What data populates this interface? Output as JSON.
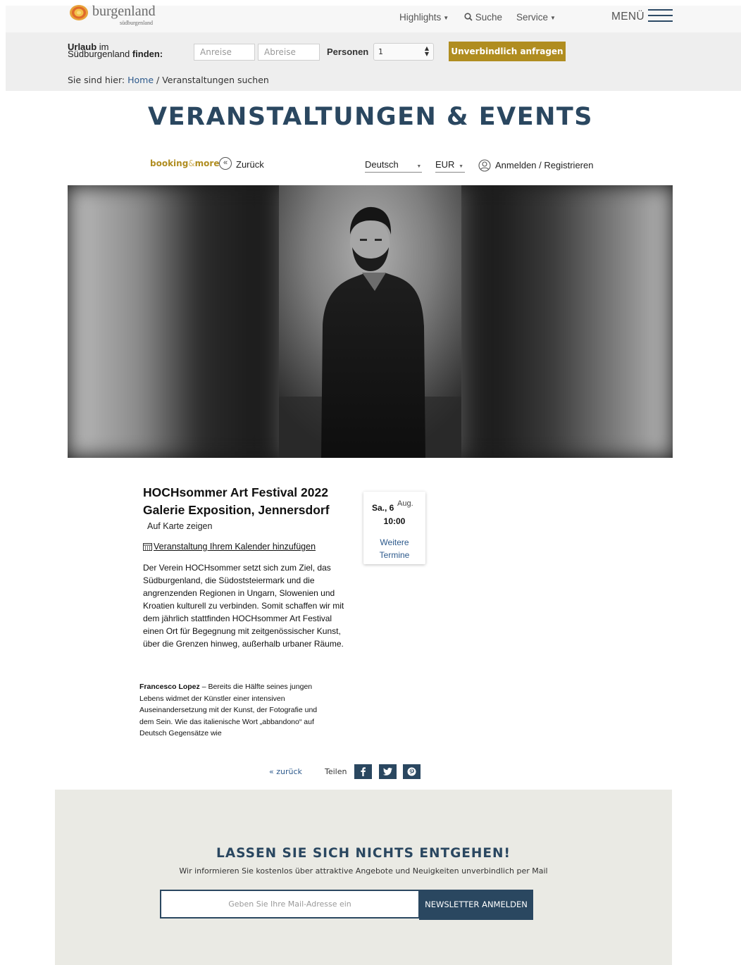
{
  "header": {
    "logo": {
      "name": "burgenland",
      "sub": "südburgenland"
    },
    "nav": [
      {
        "label": "Highlights",
        "has_caret": true
      },
      {
        "label": "Suche",
        "icon": "search-icon"
      },
      {
        "label": "Service",
        "has_caret": true
      }
    ],
    "menu_label": "MENÜ"
  },
  "booking_bar": {
    "label_bold_1": "Urlaub",
    "label_1": " im",
    "label_2": "Südburgenland ",
    "label_bold_2": "finden:",
    "arrival_placeholder": "Anreise",
    "departure_placeholder": "Abreise",
    "persons_label": "Personen",
    "persons_value": "1",
    "inquire_button": "Unverbindlich anfragen"
  },
  "breadcrumb": {
    "prefix": "Sie sind hier:",
    "home": "Home",
    "separator": " / ",
    "current": "Veranstaltungen suchen"
  },
  "page_title": "VERANSTALTUNGEN & EVENTS",
  "toolbar": {
    "brand_part1": "booking",
    "brand_amp": "&",
    "brand_part2": "more",
    "back_label": "Zurück",
    "language": "Deutsch",
    "currency": "EUR",
    "login_label": "Anmelden / Registrieren"
  },
  "event": {
    "title_line1": "HOCHsommer Art Festival 2022",
    "title_line2": "Galerie Exposition, Jennersdorf",
    "map_link": "Auf Karte zeigen",
    "calendar_link": "Veranstaltung Ihrem Kalender hinzufügen",
    "description": "Der Verein HOCHsommer setzt sich zum Ziel, das Südburgenland, die Südoststeiermark und die angrenzenden Regionen in Ungarn, Slowenien und Kroatien kulturell zu verbinden. Somit schaffen wir mit dem jährlich stattfinden HOCHsommer Art Festival einen Ort für Begegnung mit zeitgenössischer Kunst, über die Grenzen hinweg, außerhalb urbaner Räume.",
    "date": {
      "day": "Sa., 6",
      "month": "Aug.",
      "time": "10:00",
      "more_line1": "Weitere",
      "more_line2": "Termine"
    },
    "artist_name": "Francesco Lopez",
    "artist_text": " – Bereits die Hälfte seines jungen Lebens widmet der Künstler einer intensiven Auseinandersetzung mit der Kunst, der Fotografie und dem Sein. Wie das italienische Wort „abbandono“ auf Deutsch Gegensätze wie"
  },
  "share": {
    "back_label": "« zurück",
    "share_label": "Teilen",
    "buttons": [
      "facebook-icon",
      "twitter-icon",
      "pinterest-icon"
    ]
  },
  "newsletter": {
    "title": "LASSEN SIE SICH NICHTS ENTGEHEN!",
    "subtitle": "Wir informieren Sie kostenlos über attraktive Angebote und Neuigkeiten unverbindlich per Mail",
    "placeholder": "Geben Sie Ihre Mail-Adresse ein",
    "button": "NEWSLETTER ANMELDEN"
  },
  "colors": {
    "brand_navy": "#2a4760",
    "brand_gold": "#b08d20",
    "link_blue": "#2d5a8c",
    "newsletter_bg": "#eaeae4"
  }
}
